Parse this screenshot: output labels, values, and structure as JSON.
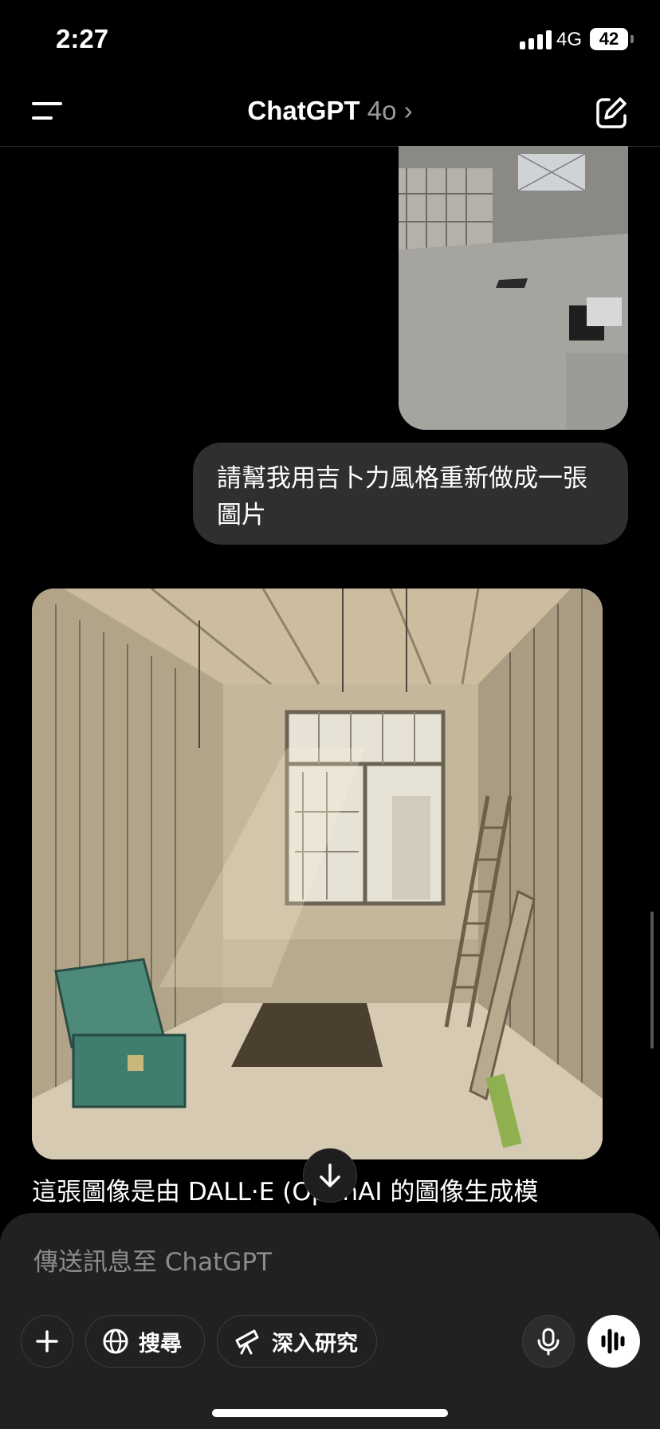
{
  "status": {
    "time": "2:27",
    "network": "4G",
    "battery": "42"
  },
  "header": {
    "title": "ChatGPT",
    "model": "4o",
    "chevron": "›"
  },
  "messages": {
    "user_text": "請幫我用吉卜力風格重新做成一張圖片",
    "assistant_text": "這張圖像是由 DALL·E (OpenAI 的圖像生成模"
  },
  "composer": {
    "placeholder": "傳送訊息至 ChatGPT",
    "search_label": "搜尋",
    "research_label": "深入研究"
  },
  "icons": [
    "menu-icon",
    "compose-icon",
    "arrow-down-icon",
    "plus-icon",
    "globe-icon",
    "telescope-icon",
    "mic-icon",
    "voice-wave-icon"
  ]
}
